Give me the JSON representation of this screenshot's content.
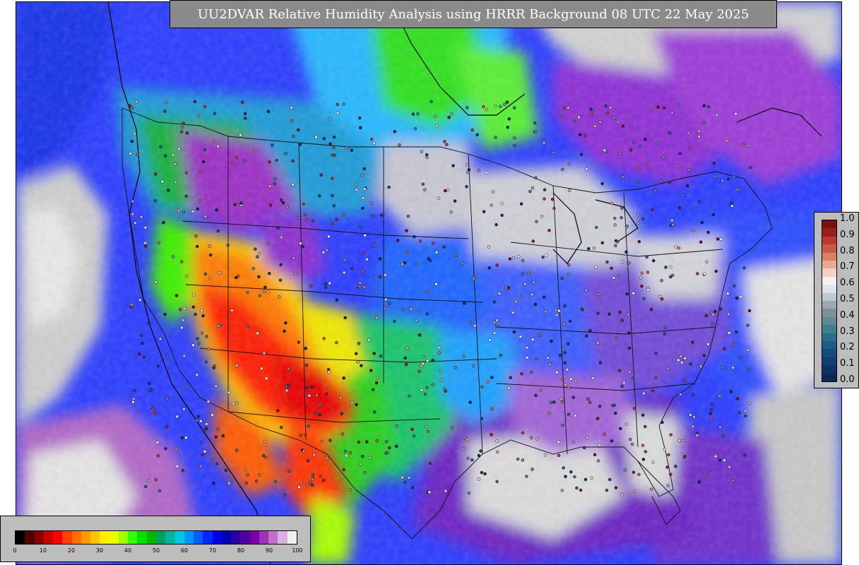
{
  "title": "UU2DVAR Relative Humidity Analysis using HRRR Background 08 UTC 22 May 2025",
  "obs_legend": {
    "labels": [
      "1.0",
      "0.9",
      "0.8",
      "0.7",
      "0.6",
      "0.5",
      "0.4",
      "0.3",
      "0.2",
      "0.1",
      "0.0"
    ],
    "colors": [
      "#7a0f14",
      "#9e1a1f",
      "#b73a30",
      "#c75a45",
      "#d97f63",
      "#e9a98f",
      "#f3d2c4",
      "#f2f2f2",
      "#dfe4ea",
      "#bfc9d2",
      "#9ba9b3",
      "#7d8f98",
      "#5e8a95",
      "#3e7f8f",
      "#2a6f8a",
      "#1f5b86",
      "#174a7d",
      "#123d70",
      "#0f3266",
      "#0a2a5a"
    ]
  },
  "rh_legend": {
    "ticks": [
      "0",
      "10",
      "20",
      "30",
      "40",
      "50",
      "60",
      "70",
      "80",
      "90",
      "100"
    ],
    "colors": [
      "#000000",
      "#550000",
      "#8b0000",
      "#cc0000",
      "#ff0000",
      "#ff4000",
      "#ff7000",
      "#ff9a00",
      "#ffc400",
      "#ffee00",
      "#e6ff00",
      "#a0ff00",
      "#33ff00",
      "#00e000",
      "#00b800",
      "#00a060",
      "#00b4a0",
      "#00c8e0",
      "#0098ff",
      "#0060ff",
      "#0028ff",
      "#0000e6",
      "#0000b0",
      "#2a00a0",
      "#5000a0",
      "#7a00a8",
      "#a030b8",
      "#c070c8",
      "#dcb0e0",
      "#f0f0f0"
    ]
  },
  "map": {
    "features": [
      "conus-relative-humidity-field",
      "state-borders",
      "observation-station-markers"
    ]
  }
}
